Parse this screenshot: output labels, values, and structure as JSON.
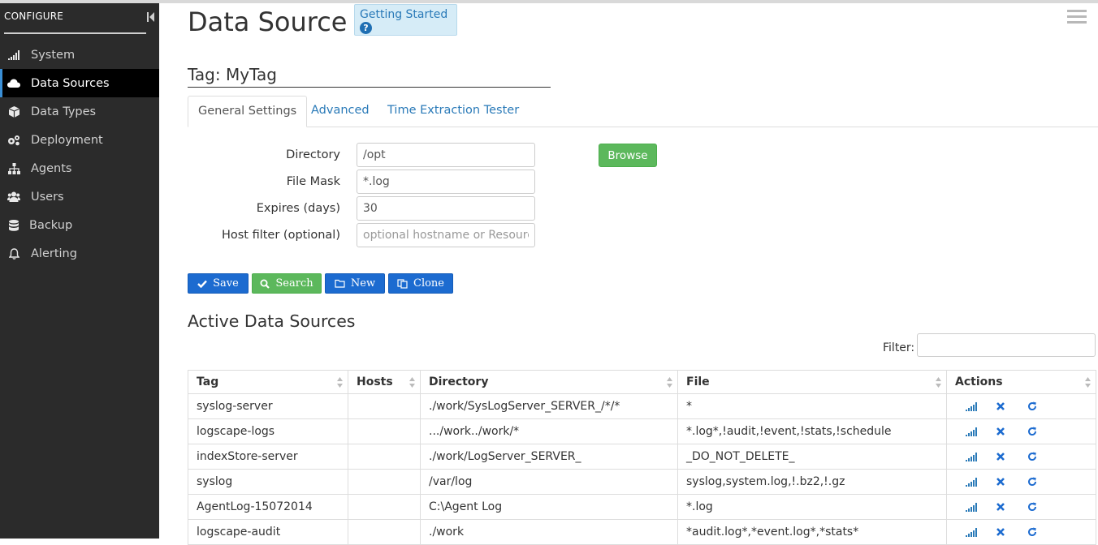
{
  "sidebar": {
    "header": "CONFIGURE",
    "items": [
      {
        "label": "System",
        "icon": "signal-bars-icon"
      },
      {
        "label": "Data Sources",
        "icon": "cloud-icon",
        "active": true
      },
      {
        "label": "Data Types",
        "icon": "cube-icon"
      },
      {
        "label": "Deployment",
        "icon": "gears-icon"
      },
      {
        "label": "Agents",
        "icon": "sitemap-icon"
      },
      {
        "label": "Users",
        "icon": "users-icon"
      },
      {
        "label": "Backup",
        "icon": "database-icon"
      },
      {
        "label": "Alerting",
        "icon": "bell-icon"
      }
    ]
  },
  "header": {
    "title": "Data Source",
    "getting_started": "Getting Started"
  },
  "tag_heading": "Tag: MyTag",
  "tabs": [
    "General Settings",
    "Advanced",
    "Time Extraction Tester"
  ],
  "form": {
    "directory": {
      "label": "Directory",
      "value": "/opt"
    },
    "file_mask": {
      "label": "File Mask",
      "value": "*.log"
    },
    "expires": {
      "label": "Expires (days)",
      "value": "30"
    },
    "host_filter": {
      "label": "Host filter (optional)",
      "value": "",
      "placeholder": "optional hostname or ResourceGroup"
    },
    "browse_label": "Browse"
  },
  "buttons": {
    "save": "Save",
    "search": "Search",
    "new": "New",
    "clone": "Clone"
  },
  "active_section": {
    "title": "Active Data Sources",
    "filter_label": "Filter:",
    "filter_value": ""
  },
  "table": {
    "columns": [
      "Tag",
      "Hosts",
      "Directory",
      "File",
      "Actions"
    ],
    "rows": [
      {
        "tag": "syslog-server",
        "hosts": "",
        "directory": "./work/SysLogServer_SERVER_/*/*",
        "file": "*"
      },
      {
        "tag": "logscape-logs",
        "hosts": "",
        "directory": ".../work../work/*",
        "file": "*.log*,!audit,!event,!stats,!schedule"
      },
      {
        "tag": "indexStore-server",
        "hosts": "",
        "directory": "./work/LogServer_SERVER_",
        "file": "_DO_NOT_DELETE_"
      },
      {
        "tag": "syslog",
        "hosts": "",
        "directory": "/var/log",
        "file": "syslog,system.log,!.bz2,!.gz"
      },
      {
        "tag": "AgentLog-15072014",
        "hosts": "",
        "directory": "C:\\Agent Log",
        "file": "*.log"
      },
      {
        "tag": "logscape-audit",
        "hosts": "",
        "directory": "./work",
        "file": "*audit.log*,*event.log*,*stats*"
      }
    ]
  },
  "colors": {
    "sidebar_bg": "#2b2b2b",
    "accent_blue": "#1c6bd0",
    "success_green": "#5cb85c",
    "link_blue": "#2a7ab8"
  }
}
